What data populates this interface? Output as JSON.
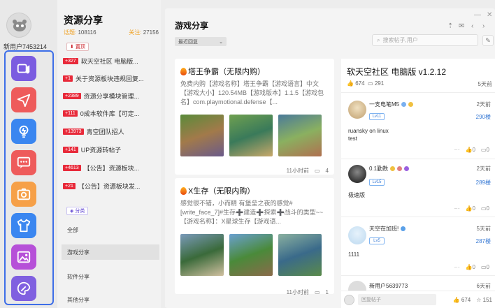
{
  "user": {
    "name": "新用户7453214"
  },
  "rail": {
    "icons": [
      {
        "name": "video-icon",
        "color": "#7b5ce0"
      },
      {
        "name": "send-icon",
        "color": "#ee5b5b"
      },
      {
        "name": "bulb-icon",
        "color": "#3a86f0"
      },
      {
        "name": "chat-icon",
        "color": "#ee5b5b"
      },
      {
        "name": "camera-icon",
        "color": "#f6a048"
      },
      {
        "name": "shirt-icon",
        "color": "#3a86f0"
      },
      {
        "name": "image-icon",
        "color": "#b650d8"
      },
      {
        "name": "palette-icon",
        "color": "#8060e0"
      }
    ]
  },
  "resources": {
    "title": "资源分享",
    "topics_label": "话题: ",
    "topics_value": "108116",
    "follow_label": "关注: ",
    "follow_value": "27156",
    "pinned_label": "置顶",
    "pinned": [
      {
        "badge": "+327",
        "text": "软天空社区 电脑版..."
      },
      {
        "badge": "+1",
        "text": "关于资源板块违规回复..."
      },
      {
        "badge": "+2389",
        "text": "资源分享模块管理..."
      },
      {
        "badge": "+111",
        "text": "0成本软件库【可定..."
      },
      {
        "badge": "+13973",
        "text": "青空团队招人"
      },
      {
        "badge": "+141",
        "text": "UP资源转帖子"
      },
      {
        "badge": "+4613",
        "text": "【公告】资源板块..."
      },
      {
        "badge": "+21",
        "text": "【公告】资源板块发..."
      }
    ],
    "category_label": "分类",
    "categories": [
      "全部",
      "游戏分享",
      "软件分享",
      "其他分享"
    ]
  },
  "main": {
    "title": "游戏分享",
    "sort_value": "最近回复",
    "search_placeholder": "搜索帖子,用户",
    "posts": [
      {
        "title": "塔王争霸（无限内购）",
        "desc": "免费内购【游戏名称】塔王争霸【游戏语言】中文【游戏大小】120.54MB【游戏版本】1.1.5【游戏包名】com.playmotional.defense【...",
        "time": "11小时前",
        "comments": "4"
      },
      {
        "title": "X生存（无限内购）",
        "desc": "感觉很不错，小而精 有堡垒之夜的感觉#[write_face_7]#生存➕建造➕探索➕战斗的类型~~【游戏名称】：X星球生存【游戏语...",
        "time": "11小时前",
        "comments": "1"
      }
    ]
  },
  "detail": {
    "title": "软天空社区 电脑版 v1.2.12",
    "likes": "674",
    "comments": "291",
    "ago": "5天前",
    "replies": [
      {
        "name": "一支电笔M5",
        "level": "Lv11",
        "time": "2天前",
        "floor": "290楼",
        "body": "ruansky on linux\ntest",
        "likes": "0",
        "comments": "0"
      },
      {
        "name": "0.1勤数",
        "level": "Lv15",
        "time": "2天前",
        "floor": "289楼",
        "body": "极速版",
        "likes": "0",
        "comments": "0"
      },
      {
        "name": "天空在加班!",
        "level": "Lv5",
        "time": "5天前",
        "floor": "287楼",
        "body": "1111",
        "likes": "0",
        "comments": "0"
      },
      {
        "name": "新用户5639773",
        "level": "",
        "time": "6天前",
        "floor": "",
        "body": "",
        "likes": "",
        "comments": ""
      }
    ],
    "reply_placeholder": "回复帖子",
    "footer_likes": "674",
    "footer_stars": "151"
  }
}
